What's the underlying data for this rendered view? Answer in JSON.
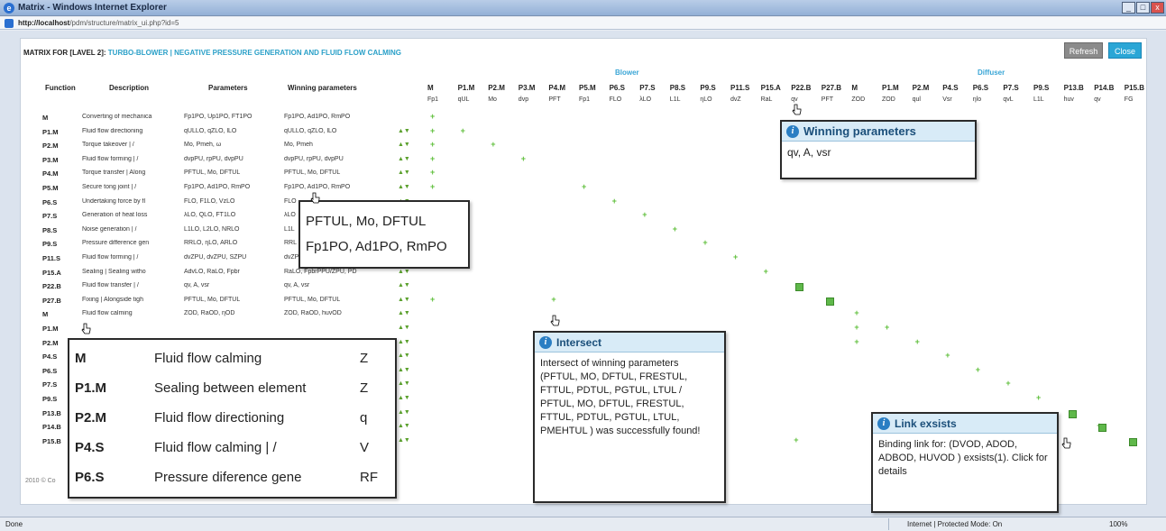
{
  "window": {
    "title": "Matrix - Windows Internet Explorer",
    "url_host": "http://localhost",
    "url_path": "/pdm/structure/matrix_ui.php?id=5"
  },
  "page": {
    "title_prefix": "MATRIX FOR [LAVEL 2]:",
    "title_highlight": "TURBO-BLOWER | NEGATIVE PRESSURE GENERATION AND FLUID FLOW CALMING",
    "refresh": "Refresh",
    "close": "Close",
    "footer": "2010 © Co"
  },
  "headers": {
    "function": "Function",
    "description": "Description",
    "parameters": "Parameters",
    "winning": "Winning parameters"
  },
  "groups": {
    "blower": "Blower",
    "diffuser": "Diffuser"
  },
  "columns": [
    {
      "code": "M",
      "param": "Fp1"
    },
    {
      "code": "P1.M",
      "param": "qUL"
    },
    {
      "code": "P2.M",
      "param": "Mo"
    },
    {
      "code": "P3.M",
      "param": "dvp"
    },
    {
      "code": "P4.M",
      "param": "PFT"
    },
    {
      "code": "P5.M",
      "param": "Fp1"
    },
    {
      "code": "P6.S",
      "param": "FLO"
    },
    {
      "code": "P7.S",
      "param": "λLO"
    },
    {
      "code": "P8.S",
      "param": "L1L"
    },
    {
      "code": "P9.S",
      "param": "ηLO"
    },
    {
      "code": "P11.S",
      "param": "dvZ"
    },
    {
      "code": "P15.A",
      "param": "RaL"
    },
    {
      "code": "P22.B",
      "param": "qv"
    },
    {
      "code": "P27.B",
      "param": "PFT"
    },
    {
      "code": "M",
      "param": "ZOD"
    },
    {
      "code": "P1.M",
      "param": "ZOD"
    },
    {
      "code": "P2.M",
      "param": "qul"
    },
    {
      "code": "P4.S",
      "param": "Vsr"
    },
    {
      "code": "P6.S",
      "param": "ηlo"
    },
    {
      "code": "P7.S",
      "param": "qvL"
    },
    {
      "code": "P9.S",
      "param": "L1L"
    },
    {
      "code": "P13.B",
      "param": "huv"
    },
    {
      "code": "P14.B",
      "param": "qv"
    },
    {
      "code": "P15.B",
      "param": "FG"
    }
  ],
  "rows": [
    {
      "fn": "M",
      "desc": "Converting of mechanica",
      "params": "Fp1PO, Up1PO, FT1PO",
      "win": "Fp1PO, Ad1PO, RmPO"
    },
    {
      "fn": "P1.M",
      "desc": "Fluid flow directioning",
      "params": "qULLO, qZLO, lLO",
      "win": "qULLO, qZLO, lLO"
    },
    {
      "fn": "P2.M",
      "desc": "Torque takeover | /",
      "params": "Mo, Pmeh, ω",
      "win": "Mo, Pmeh"
    },
    {
      "fn": "P3.M",
      "desc": "Fluid flow forming | /",
      "params": "dvpPU, rpPU, dvpPU",
      "win": "dvpPU, rpPU, dvpPU"
    },
    {
      "fn": "P4.M",
      "desc": "Torque transfer | Along",
      "params": "PFTUL, Mo, DFTUL",
      "win": "PFTUL, Mo, DFTUL"
    },
    {
      "fn": "P5.M",
      "desc": "Secure tong joint | /",
      "params": "Fp1PO, Ad1PO, RmPO",
      "win": "Fp1PO, Ad1PO, RmPO"
    },
    {
      "fn": "P6.S",
      "desc": "Undertaking force by fl",
      "params": "FLO, F1LO, VzLO",
      "win": "FLO"
    },
    {
      "fn": "P7.S",
      "desc": "Generation of heat loss",
      "params": "λLO, QLO, FT1LO",
      "win": "λLO"
    },
    {
      "fn": "P8.S",
      "desc": "Noise generation | /",
      "params": "L1LO, L2LO, NRLO",
      "win": "L1L"
    },
    {
      "fn": "P9.S",
      "desc": "Pressure difference gen",
      "params": "RRLO, ηLO, ARLO",
      "win": "RRL"
    },
    {
      "fn": "P11.S",
      "desc": "Fluid flow forming | /",
      "params": "dvZPU, dvZPU, SZPU",
      "win": "dvZPU"
    },
    {
      "fn": "P15.A",
      "desc": "Sealing | Sealing witho",
      "params": "AdvLO, RaLO, Fpbr",
      "win": "RaLO, FpbrPPU/ZPU, PD"
    },
    {
      "fn": "P22.B",
      "desc": "Fluid flow transfer | /",
      "params": "qv, A, vsr",
      "win": "qv, A, vsr"
    },
    {
      "fn": "P27.B",
      "desc": "Fixing | Alongside tigh",
      "params": "PFTUL, Mo, DFTUL",
      "win": "PFTUL, Mo, DFTUL"
    },
    {
      "fn": "M",
      "desc": "Fluid flow calming",
      "params": "ZOD, RaOD, ηOD",
      "win": "ZOD, RaOD, huvOD"
    },
    {
      "fn": "P1.M",
      "desc": "",
      "params": "",
      "win": ""
    },
    {
      "fn": "P2.M",
      "desc": "",
      "params": "",
      "win": ""
    },
    {
      "fn": "P4.S",
      "desc": "",
      "params": "",
      "win": ""
    },
    {
      "fn": "P6.S",
      "desc": "",
      "params": "",
      "win": ""
    },
    {
      "fn": "P7.S",
      "desc": "",
      "params": "",
      "win": ""
    },
    {
      "fn": "P9.S",
      "desc": "",
      "params": "",
      "win": ""
    },
    {
      "fn": "P13.B",
      "desc": "",
      "params": "",
      "win": ""
    },
    {
      "fn": "P14.B",
      "desc": "",
      "params": "",
      "win": ""
    },
    {
      "fn": "P15.B",
      "desc": "",
      "params": "",
      "win": ""
    }
  ],
  "popups": {
    "winning": {
      "title": "Winning parameters",
      "body": "qv, A, vsr"
    },
    "params_tip": {
      "line1": "PFTUL, Mo, DFTUL",
      "line2": "Fp1PO, Ad1PO, RmPO"
    },
    "intersect": {
      "title": "Intersect",
      "body": "Intersect of winning parameters (PFTUL, MO, DFTUL, FRESTUL, FTTUL, PDTUL, PGTUL, LTUL / PFTUL, MO, DFTUL, FRESTUL, FTTUL, PDTUL, PGTUL, LTUL, PMEHTUL ) was successfully found!"
    },
    "link": {
      "title": "Link exsists",
      "body": "Binding link for: (DVOD, ADOD, ADBOD, HUVOD ) exsists(1). Click for details"
    },
    "zoomlist": [
      {
        "code": "M",
        "text": "Fluid flow calming",
        "p": "Z"
      },
      {
        "code": "P1.M",
        "text": "Sealing between element",
        "p": "Z"
      },
      {
        "code": "P2.M",
        "text": "Fluid flow directioning",
        "p": "q"
      },
      {
        "code": "P4.S",
        "text": "Fluid flow calming | /",
        "p": "V"
      },
      {
        "code": "P6.S",
        "text": "Pressure diference gene",
        "p": "RF"
      }
    ]
  },
  "status": {
    "left": "Done",
    "zone": "Internet | Protected Mode: On",
    "zoom": "100%"
  }
}
